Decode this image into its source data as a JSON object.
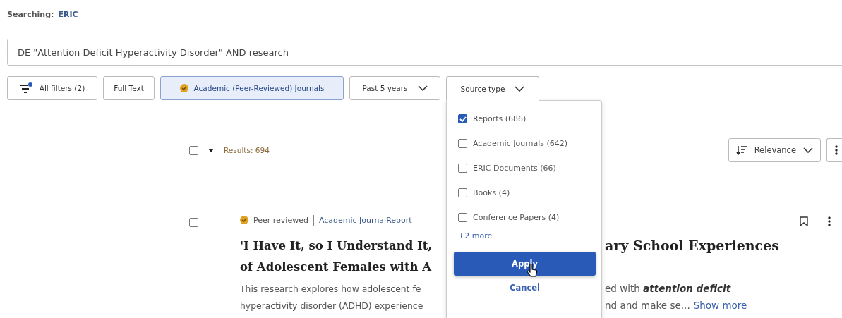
{
  "searching": {
    "label": "Searching:",
    "database": "ERIC"
  },
  "search": {
    "value": "DE \"Attention Deficit Hyperactivity Disorder\" AND research"
  },
  "filters": [
    {
      "kind": "all",
      "label": "All filters (2)"
    },
    {
      "kind": "toggle",
      "label": "Full Text",
      "selected": false
    },
    {
      "kind": "toggle",
      "label": "Academic (Peer-Reviewed) Journals",
      "selected": true
    },
    {
      "kind": "dropdown",
      "label": "Past 5 years",
      "expanded": false
    },
    {
      "kind": "dropdown",
      "label": "Source type",
      "expanded": true
    }
  ],
  "source_menu": {
    "options": [
      {
        "label": "Reports (686)",
        "checked": true
      },
      {
        "label": "Academic Journals (642)",
        "checked": false
      },
      {
        "label": "ERIC Documents (66)",
        "checked": false
      },
      {
        "label": "Books (4)",
        "checked": false
      },
      {
        "label": "Conference Papers (4)",
        "checked": false
      }
    ],
    "more": "+2 more",
    "apply": "Apply",
    "cancel": "Cancel"
  },
  "results_bar": {
    "select_all": {
      "checked": false
    },
    "count": "Results: 694",
    "sort": "Relevance"
  },
  "result": {
    "checked": false,
    "badge": "Peer reviewed",
    "type": "Academic JournalReport",
    "title_lines": [
      {
        "left": "'I Have It, so I Understand It,",
        "right": "ary School Experiences"
      },
      {
        "left": "of Adolescent Females with A"
      }
    ],
    "abstract_lines": [
      {
        "left": "This research explores how adolescent fe",
        "right": "ed with **attention deficit**"
      },
      {
        "left": "hyperactivity disorder (ADHD) experience",
        "right": "nd and make se...",
        "link": "Show more"
      }
    ]
  }
}
